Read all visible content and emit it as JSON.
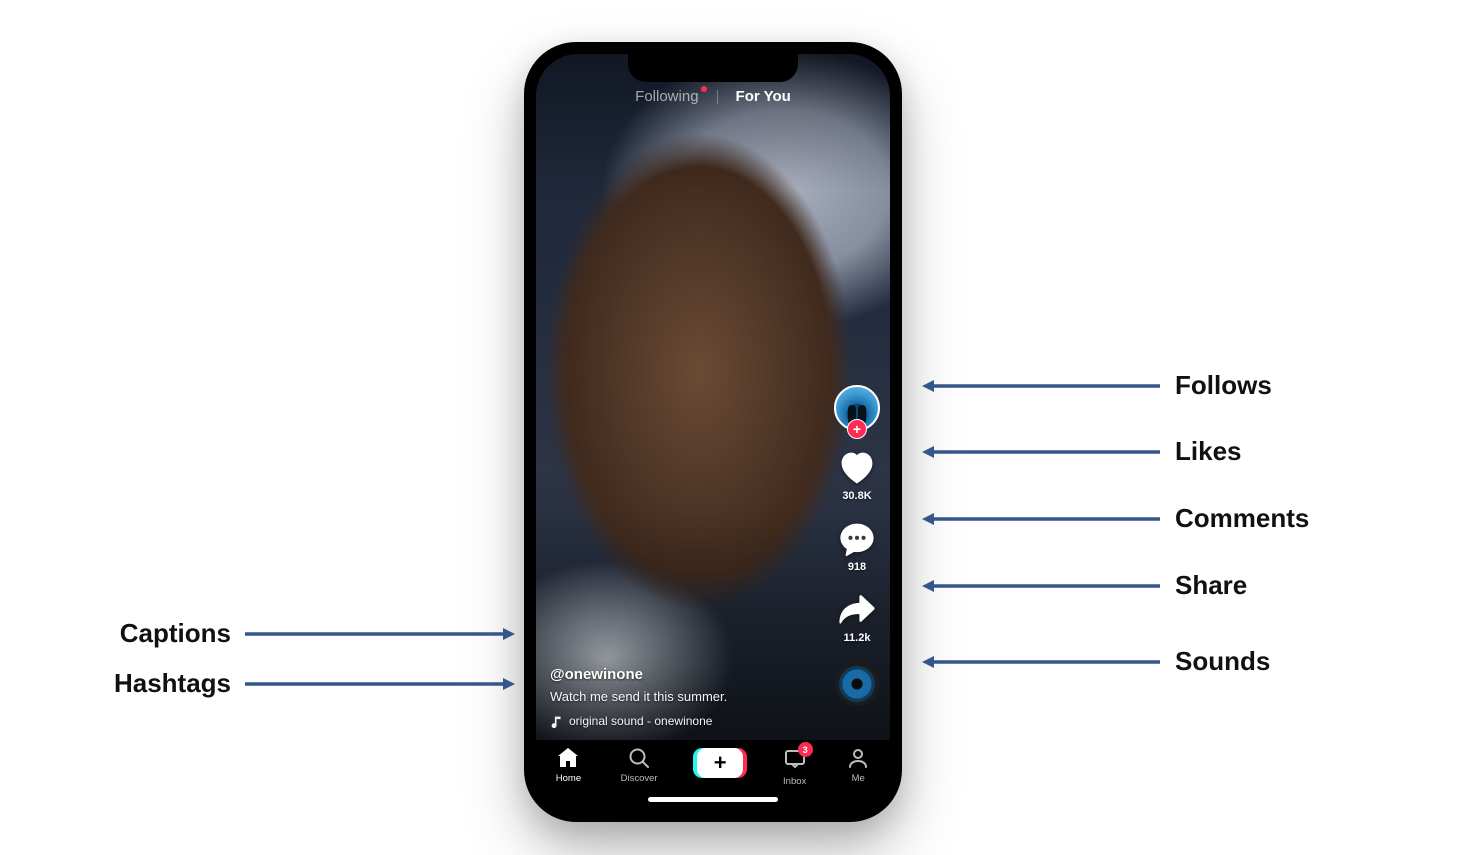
{
  "feed": {
    "tabs": {
      "following": "Following",
      "for_you": "For You"
    },
    "active_tab": "for_you",
    "following_has_dot": true
  },
  "rail": {
    "likes": "30.8K",
    "comments": "918",
    "shares": "11.2k"
  },
  "caption": {
    "username": "@onewinone",
    "text": "Watch me send it this summer.",
    "sound": "original sound - onewinone"
  },
  "nav": {
    "home": "Home",
    "discover": "Discover",
    "inbox": "Inbox",
    "inbox_badge": "3",
    "me": "Me"
  },
  "labels": {
    "follows": "Follows",
    "likes": "Likes",
    "comments": "Comments",
    "share": "Share",
    "sounds": "Sounds",
    "captions": "Captions",
    "hashtags": "Hashtags"
  },
  "colors": {
    "arrow": "#34568b",
    "accent_pink": "#fe2c55",
    "accent_cyan": "#25f4ee"
  }
}
